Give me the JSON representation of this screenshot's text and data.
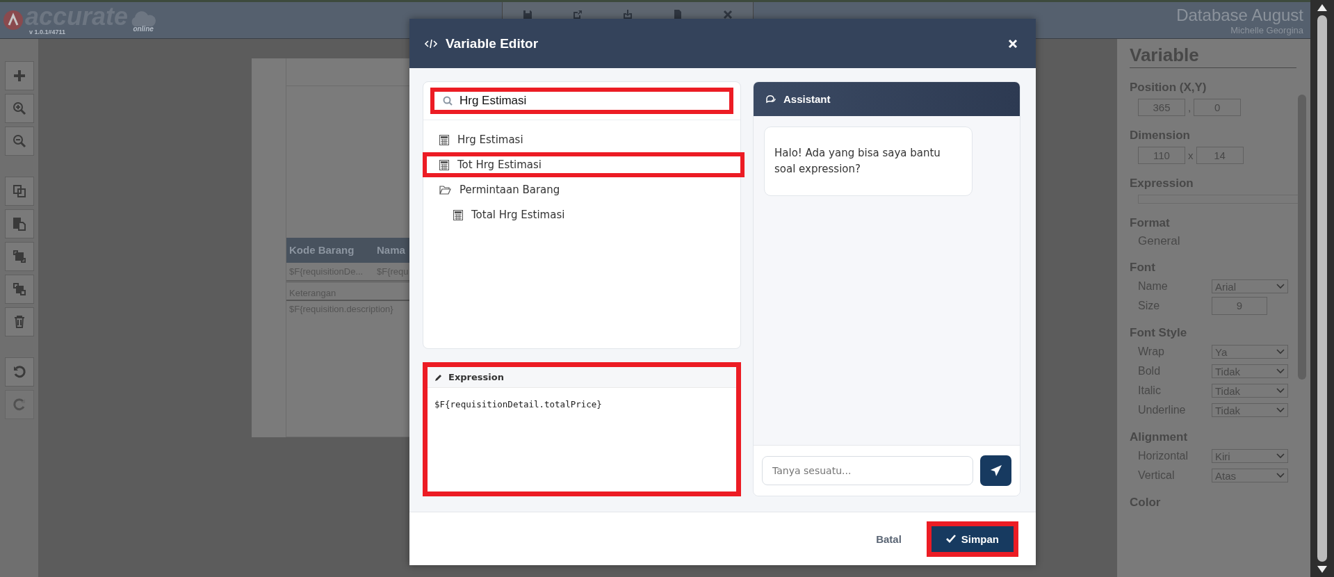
{
  "app_header": {
    "logo_text": "accurate",
    "logo_subtext": "online",
    "version": "v 1.0.1#4711",
    "database": "Database August",
    "user": "Michelle Georgina"
  },
  "document": {
    "columns": [
      "Kode Barang",
      "Nama"
    ],
    "row": [
      "$F{requisitionDe...",
      "$F{requ"
    ],
    "notes_label": "Keterangan",
    "notes_value": "$F{requisition.description}"
  },
  "properties": {
    "title": "Variable",
    "sections": [
      {
        "title": "Position (X,Y)",
        "kind": "pair",
        "values": [
          "365",
          "0"
        ],
        "separator": ","
      },
      {
        "title": "Dimension",
        "kind": "pair",
        "values": [
          "110",
          "14"
        ],
        "separator": "x"
      },
      {
        "title": "Expression",
        "kind": "field"
      },
      {
        "title": "Format",
        "kind": "text",
        "value": "General"
      },
      {
        "title": "Font",
        "kind": "rows",
        "rows": [
          {
            "label": "Name",
            "value": "Arial",
            "kind": "select"
          },
          {
            "label": "Size",
            "value": "9",
            "kind": "input"
          }
        ]
      },
      {
        "title": "Font Style",
        "kind": "rows",
        "rows": [
          {
            "label": "Wrap",
            "value": "Ya",
            "kind": "select"
          },
          {
            "label": "Bold",
            "value": "Tidak",
            "kind": "select"
          },
          {
            "label": "Italic",
            "value": "Tidak",
            "kind": "select"
          },
          {
            "label": "Underline",
            "value": "Tidak",
            "kind": "select"
          }
        ]
      },
      {
        "title": "Alignment",
        "kind": "rows",
        "rows": [
          {
            "label": "Horizontal",
            "value": "Kiri",
            "kind": "select"
          },
          {
            "label": "Vertical",
            "value": "Atas",
            "kind": "select"
          }
        ]
      },
      {
        "title": "Color",
        "kind": "heading"
      }
    ]
  },
  "modal": {
    "title": "Variable Editor",
    "search": {
      "value": "Hrg Estimasi",
      "highlighted": true
    },
    "tree": [
      {
        "label": "Hrg Estimasi",
        "kind": "variable",
        "selected": false
      },
      {
        "label": "Tot Hrg Estimasi",
        "kind": "variable",
        "selected": true
      },
      {
        "label": "Permintaan Barang",
        "kind": "folder",
        "selected": false,
        "children": [
          {
            "label": "Total Hrg Estimasi",
            "kind": "variable",
            "selected": false
          }
        ]
      }
    ],
    "expression": {
      "title": "Expression",
      "value": "$F{requisitionDetail.totalPrice}",
      "highlighted": true
    },
    "assistant": {
      "title": "Assistant",
      "messages": [
        "Halo! Ada yang bisa saya bantu soal expression?"
      ],
      "placeholder": "Tanya sesuatu..."
    },
    "cancel": "Batal",
    "save": {
      "label": "Simpan",
      "highlighted": true
    }
  }
}
